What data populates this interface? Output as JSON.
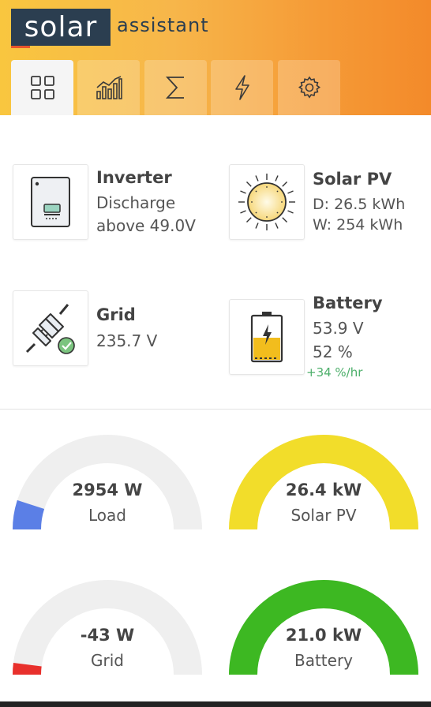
{
  "brand": {
    "logo": "solar",
    "subtitle": "assistant"
  },
  "tabs": [
    {
      "name": "dashboard",
      "icon": "grid-icon"
    },
    {
      "name": "charts",
      "icon": "chart-icon"
    },
    {
      "name": "totals",
      "icon": "sigma-icon"
    },
    {
      "name": "power",
      "icon": "lightning-icon"
    },
    {
      "name": "settings",
      "icon": "gear-icon"
    }
  ],
  "cards": {
    "inverter": {
      "title": "Inverter",
      "line1": "Discharge",
      "line2": "above 49.0V"
    },
    "solar": {
      "title": "Solar PV",
      "line1": "D: 26.5 kWh",
      "line2": "W: 254 kWh"
    },
    "grid": {
      "title": "Grid",
      "line1": "235.7 V"
    },
    "battery": {
      "title": "Battery",
      "line1": "53.9 V",
      "line2": "52 %",
      "rate": "+34 %/hr"
    }
  },
  "gauges": {
    "load": {
      "value": "2954 W",
      "label": "Load",
      "fraction": 0.1,
      "color": "#5b7fe6"
    },
    "solar": {
      "value": "26.4 kW",
      "label": "Solar PV",
      "fraction": 1.0,
      "color": "#f2dd2a"
    },
    "grid": {
      "value": "-43 W",
      "label": "Grid",
      "fraction": 0.04,
      "color": "#e8302c"
    },
    "battery": {
      "value": "21.0 kW",
      "label": "Battery",
      "fraction": 1.0,
      "color": "#3db822"
    }
  }
}
